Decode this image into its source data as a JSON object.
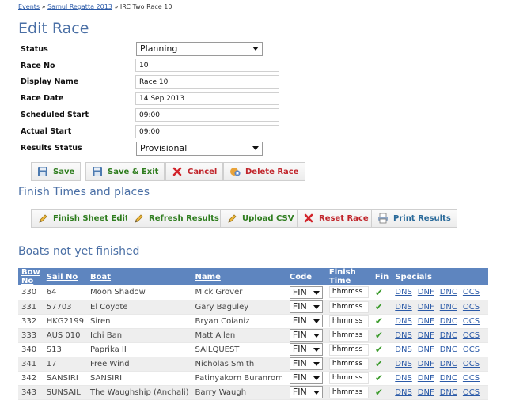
{
  "breadcrumb": {
    "items": [
      "Events",
      "Samul Regatta 2013",
      "IRC Two Race 10"
    ],
    "separator": "»"
  },
  "page_title": "Edit Race",
  "form": {
    "status_label": "Status",
    "status_value": "Planning",
    "race_no_label": "Race No",
    "race_no_value": "10",
    "display_name_label": "Display Name",
    "display_name_value": "Race 10",
    "race_date_label": "Race Date",
    "race_date_value": "14 Sep 2013",
    "scheduled_start_label": "Scheduled Start",
    "scheduled_start_value": "09:00",
    "actual_start_label": "Actual Start",
    "actual_start_value": "09:00",
    "results_status_label": "Results Status",
    "results_status_value": "Provisional"
  },
  "actions": {
    "save": "Save",
    "save_exit": "Save & Exit",
    "cancel": "Cancel",
    "delete": "Delete Race"
  },
  "finish_section": {
    "title": "Finish Times and places",
    "finish_sheet_edit": "Finish Sheet Edit",
    "refresh_results": "Refresh Results",
    "upload_csv": "Upload CSV",
    "reset_race": "Reset Race",
    "print_results": "Print Results"
  },
  "boats_section": {
    "title": "Boats not yet finished",
    "columns": {
      "bow_no": "Bow No",
      "sail_no": "Sail No",
      "boat": "Boat",
      "name": "Name",
      "code": "Code",
      "finish_time": "Finish Time",
      "fin": "Fin",
      "specials": "Specials"
    },
    "rows": [
      {
        "bow_no": "330",
        "sail_no": "64",
        "boat": "Moon Shadow",
        "name": "Mick Grover",
        "code": "FIN",
        "finish_time": "hhmmss",
        "specials": [
          "DNS",
          "DNF",
          "DNC",
          "OCS"
        ]
      },
      {
        "bow_no": "331",
        "sail_no": "57703",
        "boat": "El Coyote",
        "name": "Gary Baguley",
        "code": "FIN",
        "finish_time": "hhmmss",
        "specials": [
          "DNS",
          "DNF",
          "DNC",
          "OCS"
        ]
      },
      {
        "bow_no": "332",
        "sail_no": "HKG2199",
        "boat": "Siren",
        "name": "Bryan Coianiz",
        "code": "FIN",
        "finish_time": "hhmmss",
        "specials": [
          "DNS",
          "DNF",
          "DNC",
          "OCS"
        ]
      },
      {
        "bow_no": "333",
        "sail_no": "AUS 010",
        "boat": "Ichi Ban",
        "name": "Matt Allen",
        "code": "FIN",
        "finish_time": "hhmmss",
        "specials": [
          "DNS",
          "DNF",
          "DNC",
          "OCS"
        ]
      },
      {
        "bow_no": "340",
        "sail_no": "S13",
        "boat": "Paprika II",
        "name": "SAILQUEST",
        "code": "FIN",
        "finish_time": "hhmmss",
        "specials": [
          "DNS",
          "DNF",
          "DNC",
          "OCS"
        ]
      },
      {
        "bow_no": "341",
        "sail_no": "17",
        "boat": "Free Wind",
        "name": "Nicholas Smith",
        "code": "FIN",
        "finish_time": "hhmmss",
        "specials": [
          "DNS",
          "DNF",
          "DNC",
          "OCS"
        ]
      },
      {
        "bow_no": "342",
        "sail_no": "SANSIRI",
        "boat": "SANSIRI",
        "name": "Patinyakorn Buranrom",
        "code": "FIN",
        "finish_time": "hhmmss",
        "specials": [
          "DNS",
          "DNF",
          "DNC",
          "OCS"
        ]
      },
      {
        "bow_no": "343",
        "sail_no": "SUNSAIL",
        "boat": "The Waughship (Anchali)",
        "name": "Barry Waugh",
        "code": "FIN",
        "finish_time": "hhmmss",
        "specials": [
          "DNS",
          "DNF",
          "DNC",
          "OCS"
        ]
      }
    ]
  },
  "colors": {
    "heading": "#4a6fa5",
    "table_header": "#5e85bf",
    "link": "#2b5aa8",
    "save_text": "#2f7d1f",
    "danger_text": "#c0242a"
  }
}
